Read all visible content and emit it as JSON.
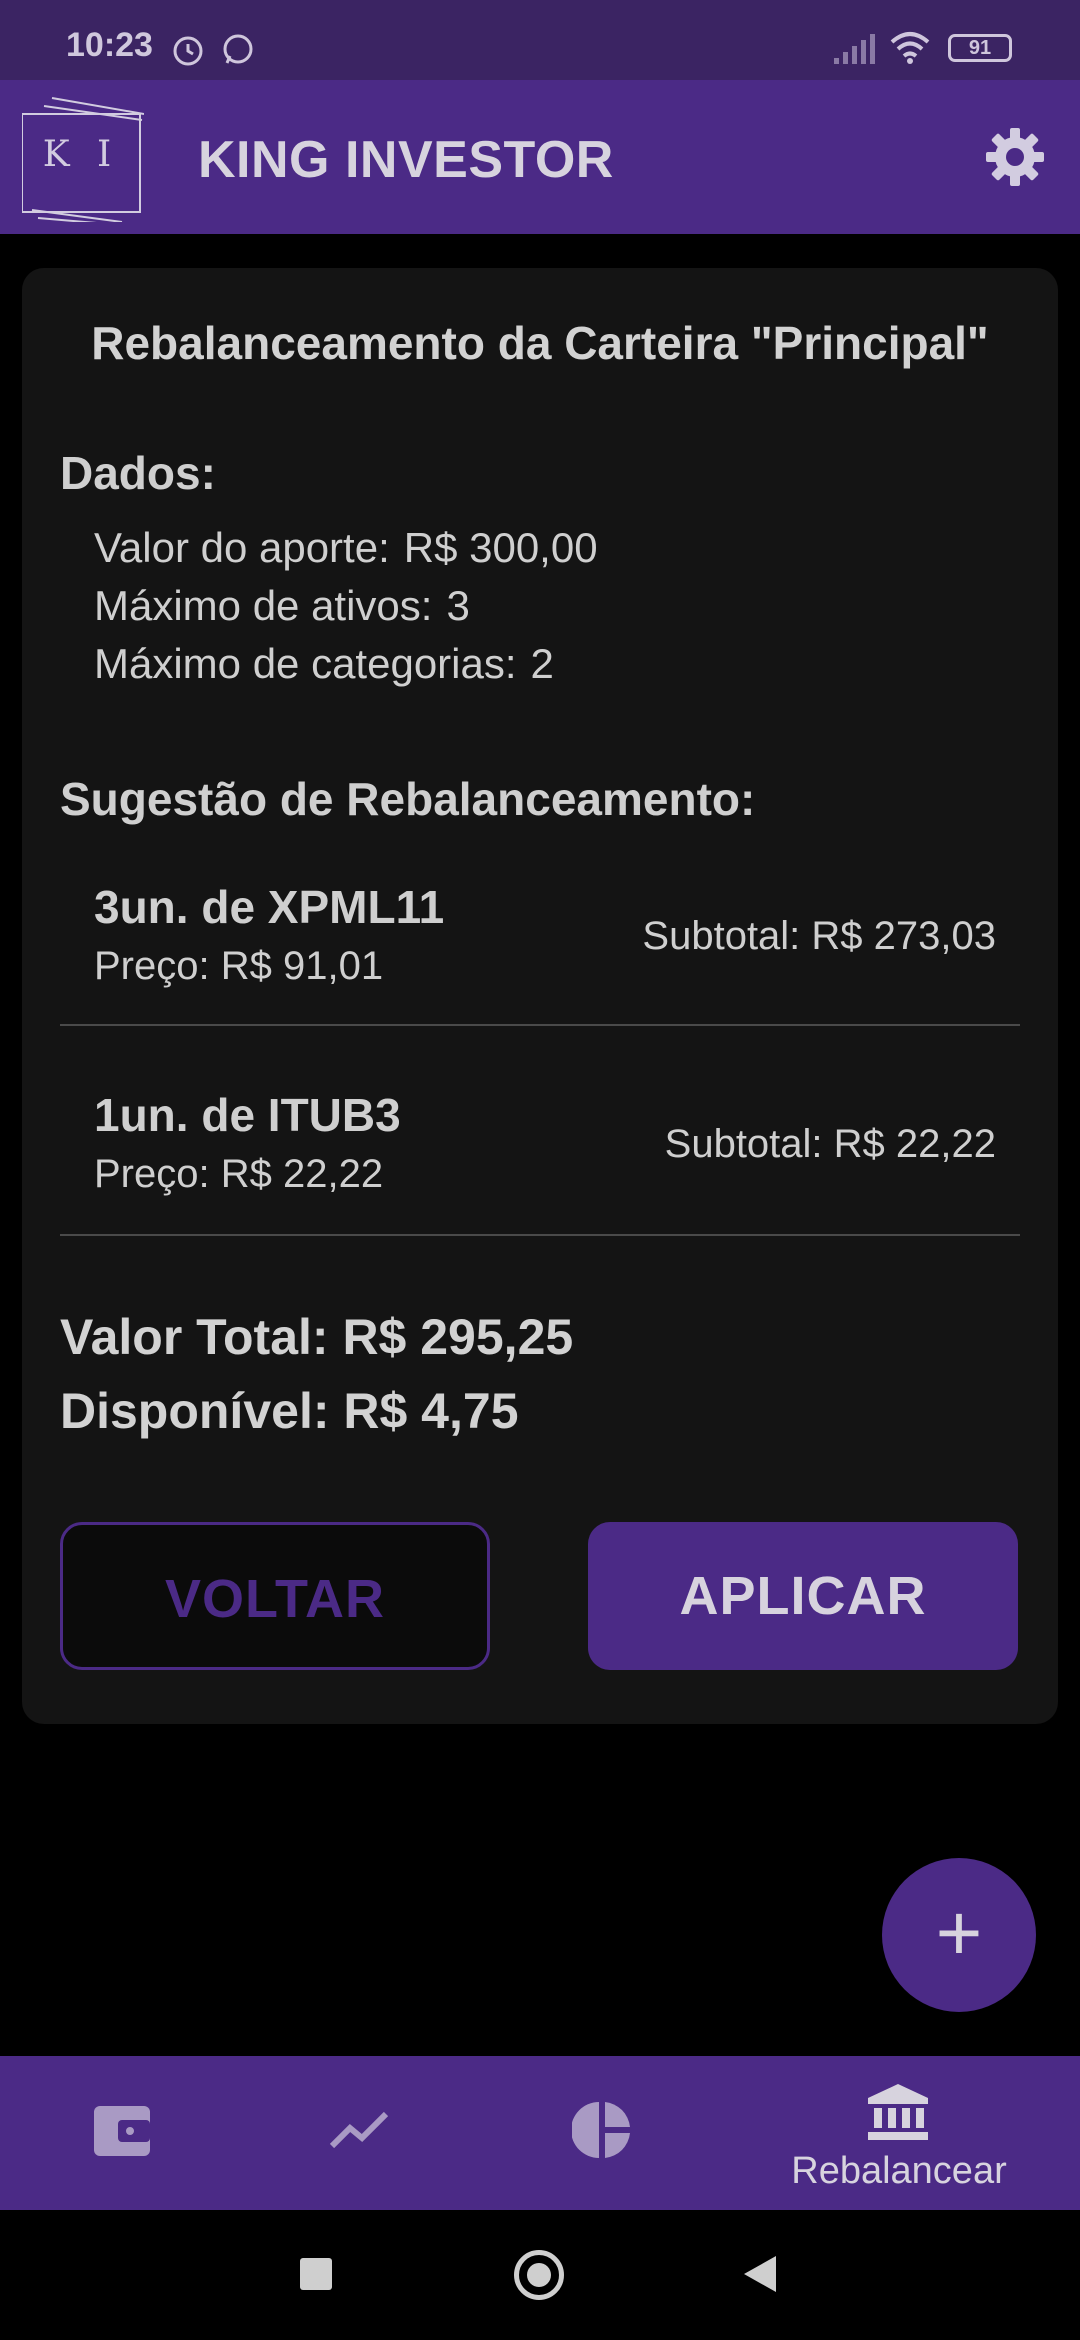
{
  "status_bar": {
    "time": "10:23",
    "battery": "91",
    "icons": [
      "alarm-icon",
      "whatsapp-icon",
      "signal-icon",
      "wifi-icon",
      "battery-icon"
    ]
  },
  "app_bar": {
    "logo_text": "K I",
    "title": "KING INVESTOR",
    "settings_icon": "gear-icon"
  },
  "card": {
    "title": "Rebalanceamento da Carteira \"Principal\"",
    "dados_title": "Dados:",
    "dados": [
      {
        "label": "Valor do aporte:",
        "value": "R$ 300,00"
      },
      {
        "label": "Máximo de ativos:",
        "value": "3"
      },
      {
        "label": "Máximo de categorias:",
        "value": "2"
      }
    ],
    "suggestion_title": "Sugestão de Rebalanceamento:",
    "items": [
      {
        "name": "3un. de XPML11",
        "price": "Preço: R$ 91,01",
        "subtotal": "Subtotal: R$ 273,03"
      },
      {
        "name": "1un. de ITUB3",
        "price": "Preço: R$ 22,22",
        "subtotal": "Subtotal: R$ 22,22"
      }
    ],
    "valor_total": "Valor Total: R$ 295,25",
    "disponivel": "Disponível: R$ 4,75",
    "btn_voltar": "VOLTAR",
    "btn_aplicar": "APLICAR"
  },
  "fab": {
    "label": "+"
  },
  "bottom_nav": {
    "items": [
      {
        "icon": "wallet-icon",
        "label": ""
      },
      {
        "icon": "trending-icon",
        "label": ""
      },
      {
        "icon": "pie-chart-icon",
        "label": ""
      },
      {
        "icon": "bank-icon",
        "label": "Rebalancear"
      }
    ]
  },
  "colors": {
    "primary": "#4b2a86",
    "status_bar": "#3b2463",
    "background": "#000000",
    "card": "#141414"
  }
}
